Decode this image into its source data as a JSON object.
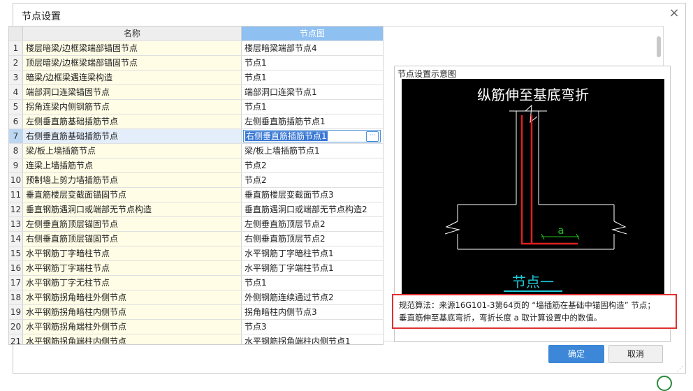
{
  "dialog": {
    "title": "节点设置",
    "close_label": "×"
  },
  "table": {
    "headers": [
      "名称",
      "节点图"
    ],
    "selected_index": 6,
    "rows": [
      {
        "num": "1",
        "name": "楼层暗梁/边框梁端部锚固节点",
        "node": "楼层暗梁端部节点4"
      },
      {
        "num": "2",
        "name": "顶层暗梁/边框梁端部锚固节点",
        "node": "节点1"
      },
      {
        "num": "3",
        "name": "暗梁/边框梁遇连梁构造",
        "node": "节点1"
      },
      {
        "num": "4",
        "name": "端部洞口连梁锚固节点",
        "node": "端部洞口连梁节点1"
      },
      {
        "num": "5",
        "name": "拐角连梁内侧钢筋节点",
        "node": "节点1"
      },
      {
        "num": "6",
        "name": "左侧垂直筋基础插筋节点",
        "node": "左侧垂直筋插筋节点1"
      },
      {
        "num": "7",
        "name": "右侧垂直筋基础插筋节点",
        "node": "右侧垂直筋插筋节点1"
      },
      {
        "num": "8",
        "name": "梁/板上墙插筋节点",
        "node": "梁/板上墙插筋节点1"
      },
      {
        "num": "9",
        "name": "连梁上墙插筋节点",
        "node": "节点2"
      },
      {
        "num": "10",
        "name": "预制墙上剪力墙插筋节点",
        "node": "节点2"
      },
      {
        "num": "11",
        "name": "垂直筋楼层变截面锚固节点",
        "node": "垂直筋楼层变截面节点3"
      },
      {
        "num": "12",
        "name": "垂直钢筋遇洞口或端部无节点构造",
        "node": "垂直筋遇洞口或端部无节点构造2"
      },
      {
        "num": "13",
        "name": "左侧垂直筋顶层锚固节点",
        "node": "左侧垂直筋顶层节点2"
      },
      {
        "num": "14",
        "name": "右侧垂直筋顶层锚固节点",
        "node": "右侧垂直筋顶层节点2"
      },
      {
        "num": "15",
        "name": "水平钢筋丁字暗柱节点",
        "node": "水平钢筋丁字暗柱节点1"
      },
      {
        "num": "16",
        "name": "水平钢筋丁字端柱节点",
        "node": "水平钢筋丁字端柱节点1"
      },
      {
        "num": "17",
        "name": "水平钢筋丁字无柱节点",
        "node": "节点1"
      },
      {
        "num": "18",
        "name": "水平钢筋拐角暗柱外侧节点",
        "node": "外侧钢筋连续通过节点2"
      },
      {
        "num": "19",
        "name": "水平钢筋拐角暗柱内侧节点",
        "node": "拐角暗柱内侧节点3"
      },
      {
        "num": "20",
        "name": "水平钢筋拐角端柱外侧节点",
        "node": "节点3"
      },
      {
        "num": "21",
        "name": "水平钢筋拐角端柱内侧节点",
        "node": "水平钢筋拐角端柱内侧节点1"
      }
    ],
    "edit_dots": "···"
  },
  "preview": {
    "label": "节点设置示意图",
    "diagram_title": "纵筋伸至基底弯折",
    "dim_label": "a",
    "node_caption": "节点一",
    "colors": {
      "bg": "#000000",
      "line": "#ffffff",
      "rebar": "#e02020",
      "dim": "#20c020",
      "caption": "#20c8d8"
    }
  },
  "description": {
    "line1": "规范算法：来源16G101-3第64页的 “墙插筋在基础中锚固构造” 节点；",
    "line2": "垂直筋伸至基底弯折，弯折长度 a 取计算设置中的数值。"
  },
  "buttons": {
    "ok": "确定",
    "cancel": "取消"
  }
}
